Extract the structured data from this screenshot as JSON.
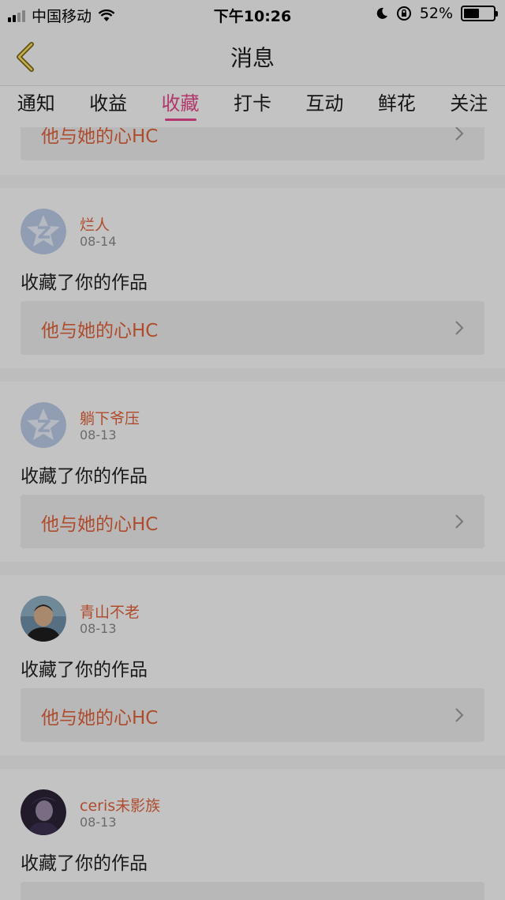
{
  "status": {
    "carrier": "中国移动",
    "time": "下午10:26",
    "battery_text": "52%",
    "battery_level": 0.52
  },
  "header": {
    "title": "消息"
  },
  "tabs": [
    {
      "label": "通知"
    },
    {
      "label": "收益"
    },
    {
      "label": "收藏",
      "active": true
    },
    {
      "label": "打卡"
    },
    {
      "label": "互动"
    },
    {
      "label": "鲜花"
    },
    {
      "label": "关注"
    }
  ],
  "partial_item": {
    "work_title": "他与她的心HC"
  },
  "items": [
    {
      "name": "烂人",
      "date": "08-14",
      "action": "收藏了你的作品",
      "work_title": "他与她的心HC",
      "avatar": "default-qq-star-icon"
    },
    {
      "name": "躺下爷压",
      "date": "08-13",
      "action": "收藏了你的作品",
      "work_title": "他与她的心HC",
      "avatar": "default-qq-star-icon"
    },
    {
      "name": "青山不老",
      "date": "08-13",
      "action": "收藏了你的作品",
      "work_title": "他与她的心HC",
      "avatar": "photo-portrait"
    },
    {
      "name": "ceris未影族",
      "date": "08-13",
      "action": "收藏了你的作品",
      "work_title": "",
      "avatar": "photo-portrait-dark"
    }
  ],
  "colors": {
    "accent": "#e4478b",
    "name": "#e0623b",
    "overlay": "rgba(0,0,0,0.22)"
  }
}
